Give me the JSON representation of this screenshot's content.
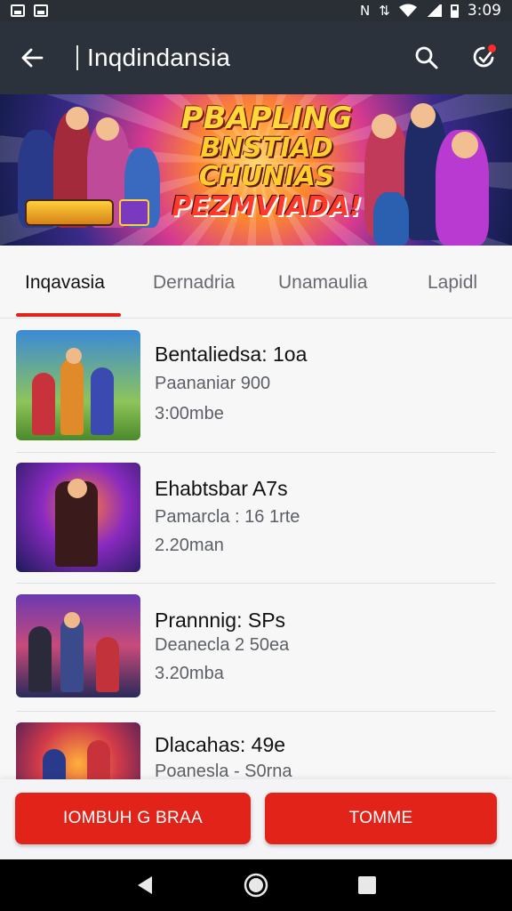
{
  "status_bar": {
    "time": "3:09",
    "icons": [
      "gallery-icon",
      "image-icon",
      "nfc-icon",
      "vibrate-icon",
      "wifi-icon",
      "signal-icon",
      "battery-icon"
    ]
  },
  "app_bar": {
    "title": "Inqdindansia",
    "icons": [
      "back-arrow-icon",
      "search-icon",
      "notification-icon"
    ]
  },
  "banner": {
    "line1": "PBAPLING",
    "line2": "BNSTIAD",
    "line3": "CHUNIAS",
    "line4": "PEZMVIADA!"
  },
  "tabs": [
    {
      "label": "Inqavasia",
      "active": true
    },
    {
      "label": "Dernadria",
      "active": false
    },
    {
      "label": "Unamaulia",
      "active": false
    },
    {
      "label": "Lapidl",
      "active": false
    }
  ],
  "list": {
    "items": [
      {
        "title": "Bentaliedsa: 1oa",
        "subtitle": "Paananiar 900",
        "size": "3:00mbe"
      },
      {
        "title": "Ehabtsbar A7s",
        "subtitle": "Pamarcla : 16 1rte",
        "size": "2.20man"
      },
      {
        "title": "Prannnig: SPs",
        "subtitle": "Deanecla 2 50ea",
        "size": "3.20mba"
      },
      {
        "title": "Dlacahas: 49e",
        "subtitle": "Poanesla - S0rna",
        "size": ""
      }
    ]
  },
  "actions": {
    "primary_label": "IOMBUH G BRAA",
    "secondary_label": "TOMME"
  },
  "colors": {
    "accent": "#e2231a",
    "app_bar": "#2c323b",
    "status_bar": "#2a2f36"
  }
}
